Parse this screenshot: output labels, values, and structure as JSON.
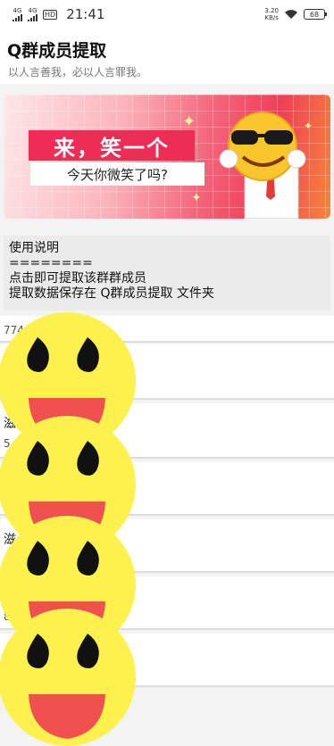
{
  "status": {
    "network1": "4G",
    "network2": "4G",
    "hd": "HD",
    "time": "21:41",
    "speed_value": "3.20",
    "speed_unit": "KB/s",
    "battery": "68"
  },
  "header": {
    "title": "Q群成员提取",
    "subtitle": "以人言善我，必以人言罪我。"
  },
  "banner": {
    "headline": "来，笑一个",
    "subline": "今天你微笑了吗?"
  },
  "instructions": {
    "heading": "使用说明",
    "separator": "========",
    "line1": "点击即可提取该群群成员",
    "line2": "提取数据保存在 Q群成员提取 文件夹"
  },
  "list": {
    "row1_fragment": "774",
    "row2_fragment": "",
    "row3_fragment": "滋",
    "row3_sub": "5",
    "row5_fragment": "滋",
    "row7_fragment": "8"
  },
  "colors": {
    "banner_red": "#ed2d56",
    "emoji_yellow": "#fcf14d",
    "emoji_mouth": "#f05050"
  }
}
